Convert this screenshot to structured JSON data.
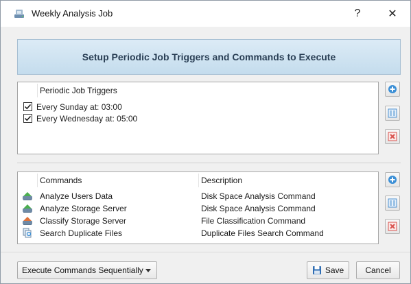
{
  "window": {
    "title": "Weekly Analysis Job",
    "help_button": "?",
    "close_button": "✕"
  },
  "banner": {
    "text": "Setup Periodic Job Triggers and Commands to Execute"
  },
  "triggers": {
    "header": "Periodic Job Triggers",
    "items": [
      {
        "label": "Every Sunday at: 03:00",
        "checked": true
      },
      {
        "label": "Every Wednesday at: 05:00",
        "checked": true
      }
    ]
  },
  "commands": {
    "headers": {
      "name": "Commands",
      "description": "Description"
    },
    "rows": [
      {
        "name": "Analyze Users Data",
        "description": "Disk Space Analysis Command",
        "icon": "disk-analysis-icon"
      },
      {
        "name": "Analyze Storage Server",
        "description": "Disk Space Analysis Command",
        "icon": "disk-analysis-icon"
      },
      {
        "name": "Classify Storage Server",
        "description": "File Classification Command",
        "icon": "file-classification-icon"
      },
      {
        "name": "Search Duplicate Files",
        "description": "Duplicate Files Search Command",
        "icon": "duplicate-search-icon"
      }
    ]
  },
  "footer": {
    "execution_mode": "Execute Commands Sequentially",
    "save_label": "Save",
    "cancel_label": "Cancel"
  },
  "colors": {
    "banner_text": "#2a3f55",
    "banner_bg": "#cfe3f1",
    "add_icon": "#3b8fd6",
    "delete_icon": "#d9534f"
  }
}
